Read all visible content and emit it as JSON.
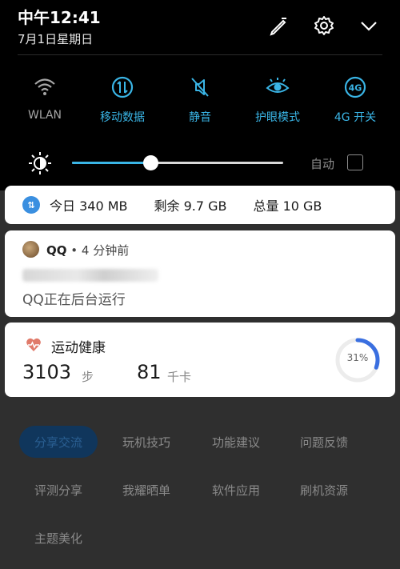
{
  "status": {
    "time": "中午12:41",
    "date": "7月1日星期日"
  },
  "header": {
    "edit_icon": "edit-icon",
    "settings_icon": "gear-icon",
    "collapse_icon": "chevron-down-icon"
  },
  "tiles": [
    {
      "label": "WLAN",
      "icon": "wifi-icon",
      "active": false
    },
    {
      "label": "移动数据",
      "icon": "mobile-data-icon",
      "active": true
    },
    {
      "label": "静音",
      "icon": "mute-icon",
      "active": true
    },
    {
      "label": "护眼模式",
      "icon": "eye-icon",
      "active": true
    },
    {
      "label": "4G 开关",
      "icon": "4g-icon",
      "active": true
    }
  ],
  "brightness": {
    "level": 0.37,
    "auto_label": "自动",
    "auto_checked": false
  },
  "data_usage": {
    "today": "今日 340 MB",
    "remaining": "剩余 9.7 GB",
    "total": "总量 10 GB"
  },
  "qq_notification": {
    "app": "QQ",
    "time": "• 4 分钟前",
    "text": "QQ正在后台运行"
  },
  "health": {
    "title": "运动健康",
    "steps": "3103",
    "steps_unit": "步",
    "kcal": "81",
    "kcal_unit": "千卡",
    "goal_percent_label": "31%",
    "goal_fraction": 0.31
  },
  "chips": [
    {
      "label": "分享交流",
      "active": true
    },
    {
      "label": "玩机技巧",
      "active": false
    },
    {
      "label": "功能建议",
      "active": false
    },
    {
      "label": "问题反馈",
      "active": false
    },
    {
      "label": "评测分享",
      "active": false
    },
    {
      "label": "我耀晒单",
      "active": false
    },
    {
      "label": "软件应用",
      "active": false
    },
    {
      "label": "刷机资源",
      "active": false
    },
    {
      "label": "主题美化",
      "active": false
    }
  ],
  "colors": {
    "accent": "#3ab5e6",
    "shade_bg": "#000000",
    "health_red": "#e07a6a",
    "ring_blue": "#3a6fe0"
  }
}
